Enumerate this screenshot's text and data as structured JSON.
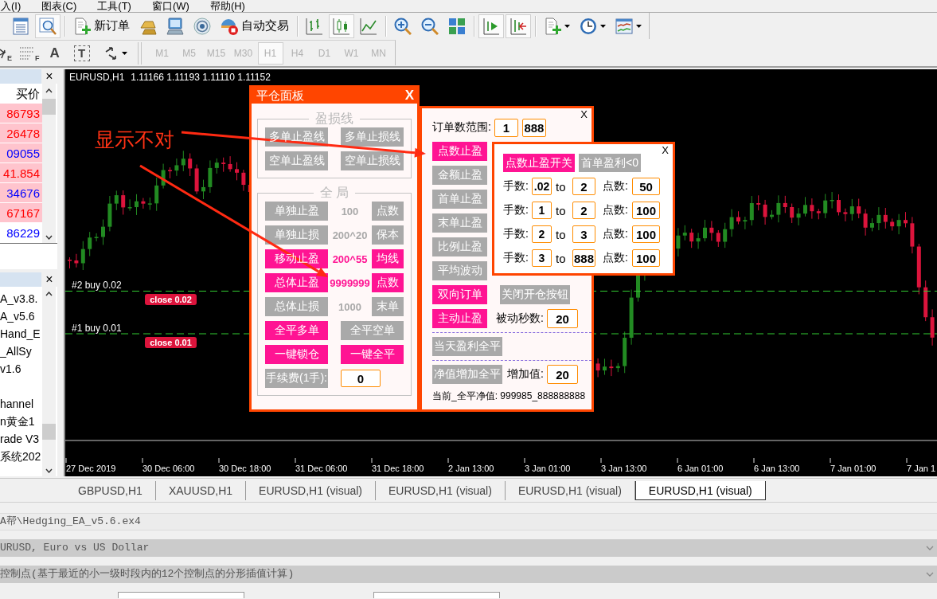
{
  "menu_bar": [
    {
      "label": "入(I)"
    },
    {
      "label": "图表(C)"
    },
    {
      "label": "工具(T)"
    },
    {
      "label": "窗口(W)"
    },
    {
      "label": "帮助(H)"
    }
  ],
  "toolbar": {
    "groups": [
      [
        {
          "pressed": false
        },
        {
          "pressed": true
        }
      ],
      [
        {
          "label": "新订单",
          "pressed": false
        },
        {
          "pressed": false
        },
        {
          "pressed": false
        },
        {
          "pressed": false
        },
        {
          "label": "自动交易",
          "pressed": false
        }
      ],
      [
        {
          "pressed": false
        },
        {
          "pressed": true
        },
        {
          "pressed": false
        }
      ],
      [
        {
          "pressed": false
        },
        {
          "pressed": false
        },
        {
          "pressed": false
        }
      ],
      [
        {
          "pressed": true
        },
        {
          "pressed": true
        }
      ],
      [
        {
          "pressed": false
        },
        {
          "pressed": false
        },
        {
          "pressed": false
        }
      ]
    ]
  },
  "drawing_toolbar": {
    "tools": [
      {
        "glyph": "E"
      },
      {
        "glyph": "F"
      },
      {
        "glyph": "A"
      },
      {
        "glyph": "T"
      }
    ],
    "periods": [
      {
        "label": "M1",
        "selected": false,
        "disabled": true
      },
      {
        "label": "M5",
        "selected": false,
        "disabled": true
      },
      {
        "label": "M15",
        "selected": false,
        "disabled": true
      },
      {
        "label": "M30",
        "selected": false,
        "disabled": true
      },
      {
        "label": "H1",
        "selected": true,
        "disabled": true
      },
      {
        "label": "H4",
        "selected": false,
        "disabled": true
      },
      {
        "label": "D1",
        "selected": false,
        "disabled": true
      },
      {
        "label": "W1",
        "selected": false,
        "disabled": true
      },
      {
        "label": "MN",
        "selected": false,
        "disabled": true
      }
    ]
  },
  "market_watch": {
    "close": "×",
    "column": "买价",
    "rows": [
      {
        "price": "86793",
        "color": "#ff0000",
        "highlighted": true
      },
      {
        "price": "26478",
        "color": "#ff0000",
        "highlighted": true
      },
      {
        "price": "09055",
        "color": "#0000ff",
        "highlighted": true
      },
      {
        "price": "41.854",
        "color": "#ff0000",
        "highlighted": true
      },
      {
        "price": "34676",
        "color": "#0000ff",
        "highlighted": true
      },
      {
        "price": "67167",
        "color": "#ff0000",
        "highlighted": true
      },
      {
        "price": "86229",
        "color": "#0000ff",
        "highlighted": false
      }
    ]
  },
  "navigator": {
    "close": "×",
    "groups": [
      [
        "A_v3.8.",
        "A_v5.6",
        "Hand_E",
        "_AllSy",
        "v1.6"
      ],
      [
        "hannel",
        "n黄金1",
        "rade V3",
        "系统202"
      ]
    ]
  },
  "chart": {
    "symbol": "EURUSD,H1",
    "ohlc": "1.11166 1.11193 1.11110 1.11152",
    "orders": [
      {
        "label": "#2 buy 0.02",
        "close_button": "close 0.02"
      },
      {
        "label": "#1 buy 0.01",
        "close_button": "close 0.01"
      }
    ],
    "time_axis": [
      "27 Dec 2019",
      "30 Dec 06:00",
      "30 Dec 18:00",
      "31 Dec 06:00",
      "31 Dec 18:00",
      "2 Jan 13:00",
      "3 Jan 01:00",
      "3 Jan 13:00",
      "6 Jan 01:00",
      "6 Jan 13:00",
      "7 Jan 01:00",
      "7 Jan 1"
    ],
    "annotation": "显示不对"
  },
  "close_panel": {
    "title": "平仓面板",
    "close": "X",
    "groups": [
      {
        "title": "盈损线",
        "rows": [
          [
            {
              "kind": "button",
              "label": "多单止盈线",
              "on": false
            },
            {
              "kind": "button",
              "label": "多单止损线",
              "on": false
            }
          ],
          [
            {
              "kind": "button",
              "label": "空单止盈线",
              "on": false
            },
            {
              "kind": "button",
              "label": "空单止损线",
              "on": false
            }
          ]
        ]
      },
      {
        "title": "全 局",
        "rows": [
          [
            {
              "kind": "button",
              "label": "单独止盈",
              "on": false
            },
            {
              "kind": "value",
              "text": "100",
              "on": false
            },
            {
              "kind": "button",
              "label": "点数",
              "on": false
            }
          ],
          [
            {
              "kind": "button",
              "label": "单独止损",
              "on": false
            },
            {
              "kind": "value",
              "text": "200^20",
              "on": false
            },
            {
              "kind": "button",
              "label": "保本",
              "on": false
            }
          ],
          [
            {
              "kind": "button",
              "label": "移动止盈",
              "on": true
            },
            {
              "kind": "value",
              "text": "200^55",
              "on": true
            },
            {
              "kind": "button",
              "label": "均线",
              "on": true
            }
          ],
          [
            {
              "kind": "button",
              "label": "总体止盈",
              "on": true
            },
            {
              "kind": "value",
              "text": "9999999",
              "on": true
            },
            {
              "kind": "button",
              "label": "点数",
              "on": true
            }
          ],
          [
            {
              "kind": "button",
              "label": "总体止损",
              "on": false
            },
            {
              "kind": "value",
              "text": "1000",
              "on": false
            },
            {
              "kind": "button",
              "label": "末单",
              "on": false
            }
          ],
          [
            {
              "kind": "button",
              "label": "全平多单",
              "on": true
            },
            {
              "kind": "button",
              "label": "全平空单",
              "on": false
            }
          ],
          [
            {
              "kind": "button",
              "label": "一键锁仓",
              "on": true
            },
            {
              "kind": "button",
              "label": "一键全平",
              "on": true
            }
          ],
          [
            {
              "kind": "button",
              "label": "手续费(1手):",
              "on": false
            },
            {
              "kind": "input",
              "value": "0"
            }
          ]
        ]
      }
    ]
  },
  "order_panel": {
    "close": "X",
    "range": {
      "label": "订单数范围:",
      "from": "1",
      "to": "888"
    },
    "rows": [
      {
        "kind": "buttons",
        "cells": [
          {
            "kind": "button",
            "label": "点数止盈",
            "on": true
          }
        ]
      },
      {
        "kind": "buttons",
        "cells": [
          {
            "kind": "button",
            "label": "金额止盈",
            "on": false
          }
        ]
      },
      {
        "kind": "buttons",
        "cells": [
          {
            "kind": "button",
            "label": "首单止盈",
            "on": false
          }
        ]
      },
      {
        "kind": "buttons",
        "cells": [
          {
            "kind": "button",
            "label": "末单止盈",
            "on": false
          }
        ]
      },
      {
        "kind": "buttons",
        "cells": [
          {
            "kind": "button",
            "label": "比例止盈",
            "on": false
          }
        ]
      },
      {
        "kind": "buttons",
        "cells": [
          {
            "kind": "button",
            "label": "平均波动",
            "on": false
          }
        ]
      },
      {
        "kind": "buttons",
        "cells": [
          {
            "kind": "button",
            "label": "双向订单",
            "on": true
          },
          {
            "kind": "button",
            "label": "关闭开仓按钮",
            "on": false
          }
        ]
      },
      {
        "kind": "buttons",
        "cells": [
          {
            "kind": "button",
            "label": "主动止盈",
            "on": true
          },
          {
            "kind": "label",
            "text": "被动秒数:"
          },
          {
            "kind": "input",
            "value": "20"
          }
        ]
      },
      {
        "kind": "divider"
      },
      {
        "kind": "buttons",
        "cells": [
          {
            "kind": "button",
            "label": "当天盈利全平",
            "on": false
          }
        ]
      },
      {
        "kind": "divider"
      },
      {
        "kind": "buttons",
        "cells": [
          {
            "kind": "button",
            "label": "净值增加全平",
            "on": false
          },
          {
            "kind": "label",
            "text": "增加值:"
          },
          {
            "kind": "input",
            "value": "20"
          }
        ]
      }
    ],
    "status": "当前_全平净值: 999985_888888888"
  },
  "tier_panel": {
    "close": "X",
    "buttons": [
      {
        "label": "点数止盈开关",
        "on": true
      },
      {
        "label": "首单盈利<0",
        "on": false
      }
    ],
    "tiers": [
      {
        "lots_label": "手数:",
        "from": ".02",
        "to_label": "to",
        "to": "2",
        "points_label": "点数:",
        "points": "50"
      },
      {
        "lots_label": "手数:",
        "from": "1",
        "to_label": "to",
        "to": "2",
        "points_label": "点数:",
        "points": "100"
      },
      {
        "lots_label": "手数:",
        "from": "2",
        "to_label": "to",
        "to": "3",
        "points_label": "点数:",
        "points": "100"
      },
      {
        "lots_label": "手数:",
        "from": "3",
        "to_label": "to",
        "to": "888",
        "points_label": "点数:",
        "points": "100"
      }
    ]
  },
  "tabs": [
    {
      "label": "GBPUSD,H1",
      "selected": false
    },
    {
      "label": "XAUUSD,H1",
      "selected": false
    },
    {
      "label": "EURUSD,H1 (visual)",
      "selected": false
    },
    {
      "label": "EURUSD,H1 (visual)",
      "selected": false
    },
    {
      "label": "EURUSD,H1 (visual)",
      "selected": false
    },
    {
      "label": "EURUSD,H1 (visual)",
      "selected": true
    }
  ],
  "tester": {
    "expert": "A帮\\Hedging_EA_v5.6.ex4",
    "symbol": "URUSD, Euro vs US Dollar",
    "model": "控制点(基于最近的小一级时段内的12个控制点的分形插值计算)"
  }
}
